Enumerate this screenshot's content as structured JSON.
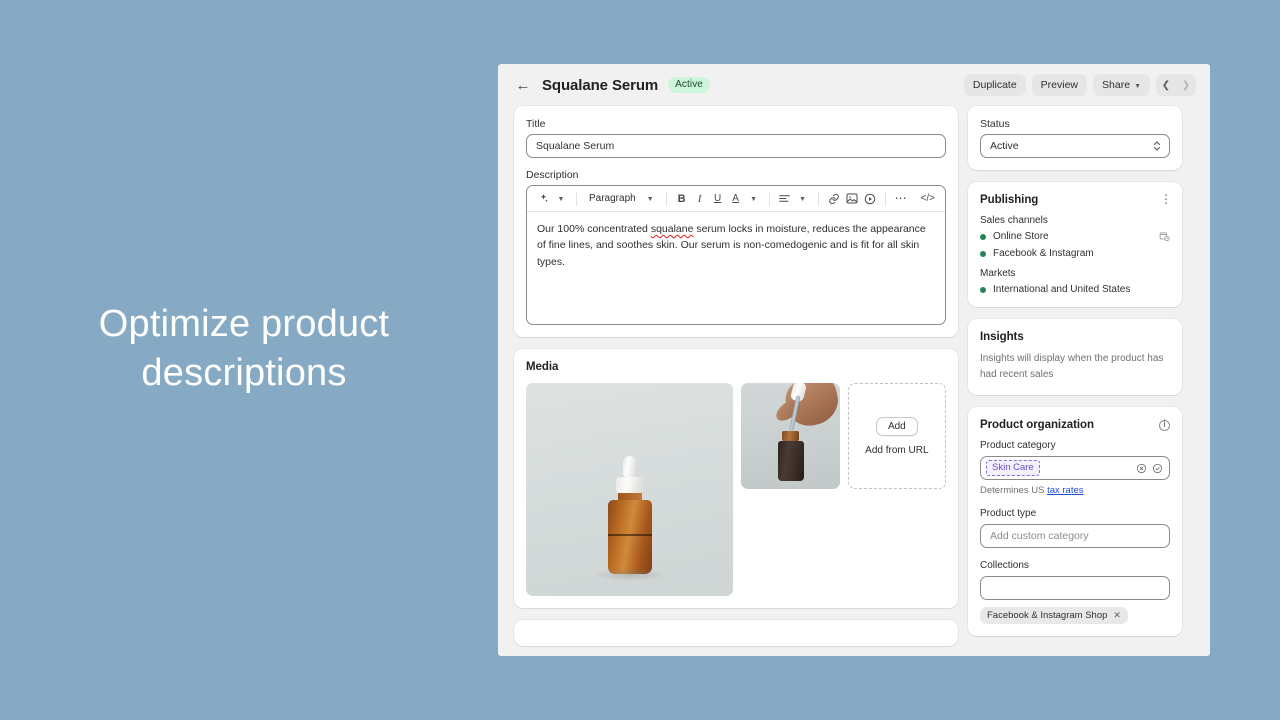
{
  "caption": {
    "line1": "Optimize product",
    "line2": "descriptions"
  },
  "topbar": {
    "back_icon": "arrow-left-icon",
    "title": "Squalane Serum",
    "status_badge": "Active",
    "duplicate_label": "Duplicate",
    "preview_label": "Preview",
    "share_label": "Share",
    "prev_icon": "chevron-left-icon",
    "next_icon": "chevron-right-icon"
  },
  "title_field": {
    "label": "Title",
    "value": "Squalane Serum"
  },
  "description": {
    "label": "Description",
    "toolbar": {
      "ai_icon": "sparkle-icon",
      "block_style": "Paragraph",
      "bold": "B",
      "italic": "I",
      "underline": "U",
      "text_color": "A",
      "align_icon": "align-left-icon",
      "link_icon": "link-icon",
      "image_icon": "image-icon",
      "video_icon": "video-icon",
      "more_icon": "ellipsis-icon",
      "code_icon": "code-icon"
    },
    "text_part1": "Our 100% concentrated ",
    "text_misspelled": "squalane",
    "text_part2": " serum locks in moisture, reduces the appearance of fine lines, and soothes skin. Our serum is non-comedogenic and is fit for all skin types."
  },
  "media": {
    "title": "Media",
    "main_image_alt": "amber glass dropper serum bottle on light gray background",
    "thumb_image_alt": "hand holding a pipette dropper above a dark serum bottle",
    "add_label": "Add",
    "add_from_url_label": "Add from URL"
  },
  "sidebar": {
    "status": {
      "label": "Status",
      "value": "Active"
    },
    "publishing": {
      "title": "Publishing",
      "menu_icon": "kebab-menu-icon",
      "sales_channels_label": "Sales channels",
      "channels": [
        {
          "name": "Online Store",
          "icon": "schedule-clock-icon"
        },
        {
          "name": "Facebook & Instagram",
          "icon": ""
        }
      ],
      "markets_label": "Markets",
      "markets": [
        {
          "name": "International and United States"
        }
      ]
    },
    "insights": {
      "title": "Insights",
      "body": "Insights will display when the product has had recent sales"
    },
    "product_organization": {
      "title": "Product organization",
      "info_icon": "info-circle-icon",
      "category_label": "Product category",
      "category_value": "Skin Care",
      "clear_icon": "circle-x-icon",
      "confirm_icon": "circle-check-icon",
      "helper_prefix": "Determines US ",
      "helper_link": "tax rates",
      "type_label": "Product type",
      "type_placeholder": "Add custom category",
      "collections_label": "Collections",
      "collections_value": "",
      "collection_chip": "Facebook & Instagram Shop",
      "chip_remove_icon": "close-x-icon"
    }
  },
  "colors": {
    "page_background": "#86aac4",
    "app_background": "#f1f1f1",
    "accent_green": "#29845a",
    "badge_green_bg": "#cdf5d9",
    "category_purple": "#6a4fc4",
    "link_blue": "#1c4ed8"
  }
}
